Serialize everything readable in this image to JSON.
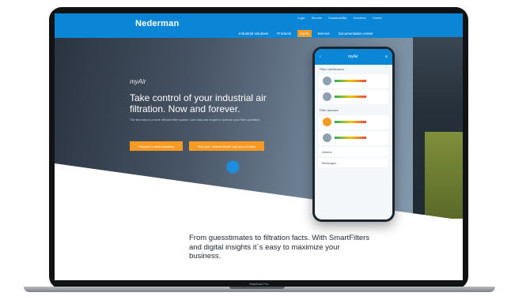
{
  "device": {
    "model_label": "MacBook Pro"
  },
  "website": {
    "logo": "Nederman",
    "utility_links": [
      "Login",
      "Service",
      "Sustainability",
      "Investors",
      "Career"
    ],
    "main_nav": {
      "items": [
        "Industrial solutions",
        "Products",
        "myAir",
        "Service",
        "Documentation center"
      ],
      "active": "myAir"
    },
    "hero": {
      "brand": "myAir",
      "headline": "Take control of your industrial air filtration. Now and forever.",
      "subtext": "The first step to a more efficient filter system. Use data and insight to optimize your filter operation.",
      "primary_cta": "Request a demonstration",
      "secondary_cta": "Find your closest dealer and your contact"
    },
    "tagline": "From guesstimates to filtration facts. With SmartFilters and digital insights it´s easy to maximize your business."
  },
  "phone_app": {
    "title": "myAir",
    "sections": [
      {
        "name": "Filter maintenance",
        "cards": 2
      },
      {
        "name": "Filter statuses",
        "cards": 2
      }
    ],
    "rows": [
      "Alarms",
      "Messages"
    ]
  },
  "colors": {
    "brand_blue": "#0b86d6",
    "accent_orange": "#f59a23",
    "dark_text": "#1d2630"
  }
}
